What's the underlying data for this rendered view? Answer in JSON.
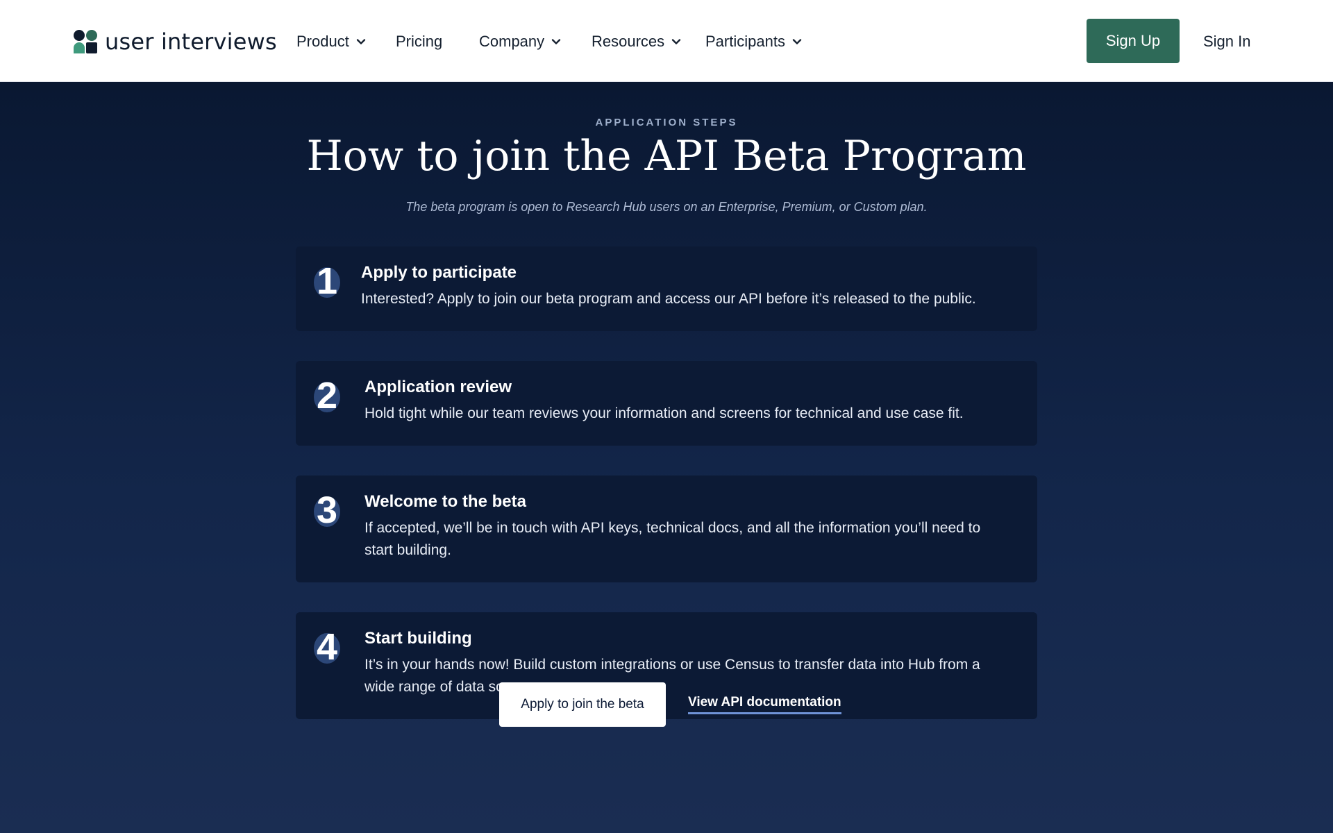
{
  "brand": {
    "name": "user interviews",
    "colors": {
      "primary": "#2e6a58",
      "dark": "#0f1b2d",
      "accent": "#6f93d8"
    }
  },
  "nav": {
    "items": [
      {
        "label": "Product",
        "has_dropdown": true
      },
      {
        "label": "Pricing",
        "has_dropdown": false
      },
      {
        "label": "Company",
        "has_dropdown": true
      },
      {
        "label": "Resources",
        "has_dropdown": true
      },
      {
        "label": "Participants",
        "has_dropdown": true
      }
    ],
    "sign_up": "Sign Up",
    "sign_in": "Sign In"
  },
  "hero": {
    "eyebrow": "APPLICATION STEPS",
    "title": "How to join the API Beta Program",
    "subtitle": "The beta program is open to Research Hub users on an Enterprise, Premium, or Custom plan."
  },
  "steps": [
    {
      "number": "1",
      "title": "Apply to participate",
      "description": "Interested? Apply to join our beta program and access our API before it’s released to the public."
    },
    {
      "number": "2",
      "title": "Application review",
      "description": "Hold tight while our team reviews your information and screens for technical and use case fit."
    },
    {
      "number": "3",
      "title": "Welcome to the beta",
      "description": "If accepted, we’ll be in touch with API keys, technical docs, and all the information you’ll need to start building."
    },
    {
      "number": "4",
      "title": "Start building",
      "description": "It’s in your hands now! Build custom integrations or use Census to transfer data into Hub from a wide range of data sources."
    }
  ],
  "cta": {
    "primary": "Apply to join the beta",
    "secondary": "View API documentation"
  }
}
